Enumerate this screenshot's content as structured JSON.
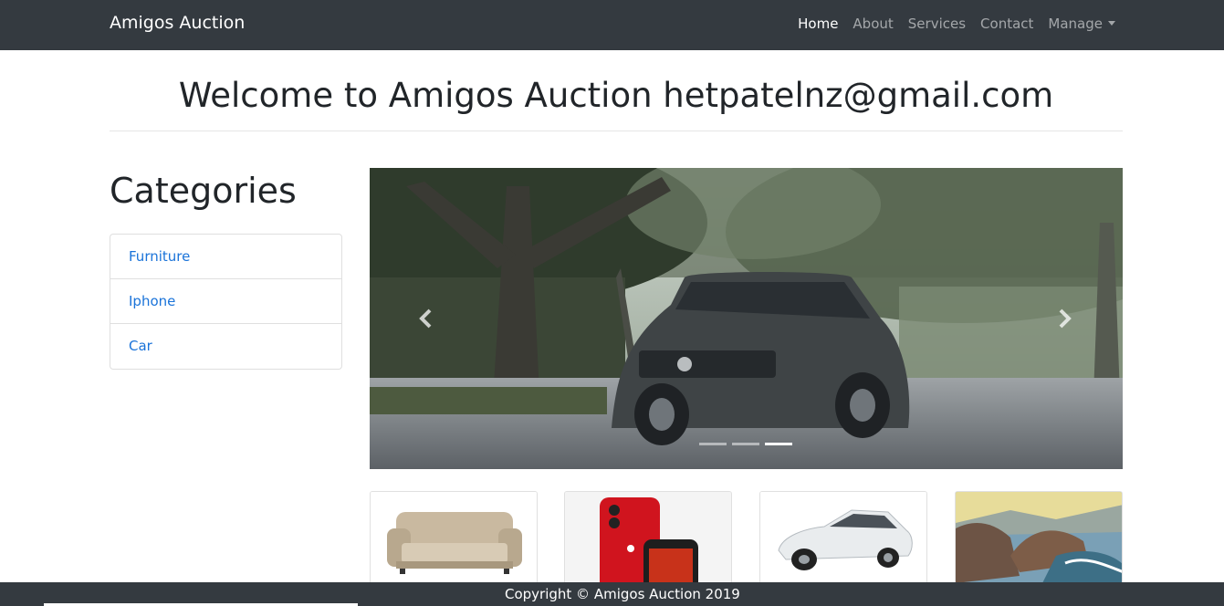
{
  "navbar": {
    "brand": "Amigos Auction",
    "items": [
      {
        "label": "Home",
        "active": true
      },
      {
        "label": "About",
        "active": false
      },
      {
        "label": "Services",
        "active": false
      },
      {
        "label": "Contact",
        "active": false
      },
      {
        "label": "Manage",
        "active": false,
        "dropdown": true
      }
    ]
  },
  "main": {
    "welcome": "Welcome to Amigos Auction hetpatelnz@gmail.com"
  },
  "sidebar": {
    "title": "Categories",
    "items": [
      {
        "label": "Furniture"
      },
      {
        "label": "Iphone"
      },
      {
        "label": "Car"
      }
    ]
  },
  "carousel": {
    "prev_icon": "chevron-left-icon",
    "next_icon": "chevron-right-icon",
    "indicators": 3,
    "active_indicator": 3
  },
  "thumbnails": [
    {
      "subject": "sofa"
    },
    {
      "subject": "red-iphone"
    },
    {
      "subject": "white-car"
    },
    {
      "subject": "seascape-painting"
    }
  ],
  "footer": {
    "text": "Copyright © Amigos Auction 2019"
  },
  "colors": {
    "navbar_bg": "#343a40",
    "link": "#1a73d9",
    "footer_bg": "#343a40"
  }
}
